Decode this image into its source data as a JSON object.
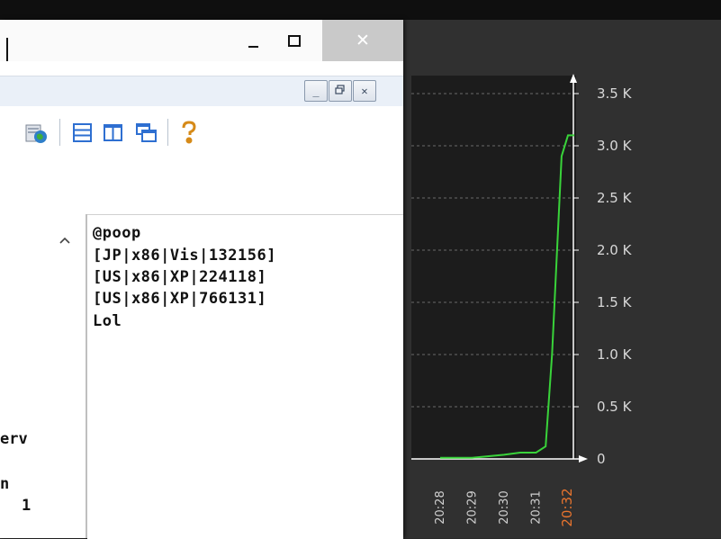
{
  "window": {
    "controls": {
      "minimize": "_",
      "close": "✕"
    }
  },
  "mdi_controls": {
    "minimize": "_",
    "restore": "🗗",
    "close": "✕"
  },
  "toolbar": {
    "icons": [
      "globe-icon",
      "horizontal-layout-icon",
      "vertical-layout-icon",
      "cascade-windows-icon",
      "help-icon"
    ]
  },
  "left_pane": {
    "fragments": [
      "erv",
      "n",
      "1"
    ]
  },
  "messages": {
    "lines": [
      "@poop",
      "[JP|x86|Vis|132156]",
      "[US|x86|XP|224118]",
      "[US|x86|XP|766131]",
      "Lol"
    ]
  },
  "chart_data": {
    "type": "line",
    "y_ticks": [
      "3.5 K",
      "3.0 K",
      "2.5 K",
      "2.0 K",
      "1.5 K",
      "1.0 K",
      "0.5 K",
      "0"
    ],
    "x_ticks": [
      "20:29",
      "20:30",
      "20:31",
      "20:32"
    ],
    "x_partial_ticks": [
      "20:28"
    ],
    "ylim": [
      0,
      3500
    ],
    "grid": true,
    "series": [
      {
        "color": "#39d33a",
        "points": [
          [
            "20:28",
            10
          ],
          [
            "20:29",
            10
          ],
          [
            "20:30",
            40
          ],
          [
            "20:30.5",
            60
          ],
          [
            "20:31",
            60
          ],
          [
            "20:31.3",
            120
          ],
          [
            "20:31.5",
            1000
          ],
          [
            "20:31.8",
            2900
          ],
          [
            "20:32",
            3100
          ],
          [
            "20:32.2",
            3100
          ]
        ]
      }
    ],
    "highlight_tick_color": "#e8742e"
  }
}
